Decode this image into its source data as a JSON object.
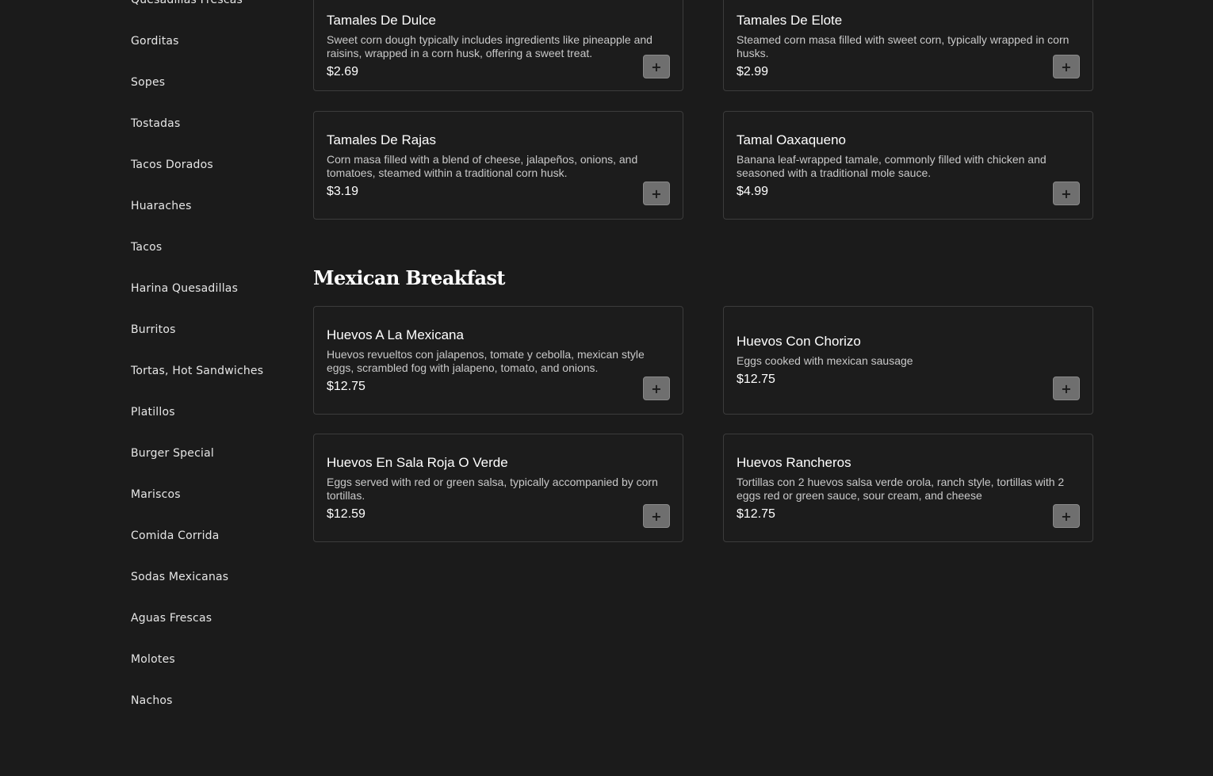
{
  "sidebar": {
    "items": [
      "Quesadillas Frescas",
      "Gorditas",
      "Sopes",
      "Tostadas",
      "Tacos Dorados",
      "Huaraches",
      "Tacos",
      "Harina Quesadillas",
      "Burritos",
      "Tortas, Hot Sandwiches",
      "Platillos",
      "Burger Special",
      "Mariscos",
      "Comida Corrida",
      "Sodas Mexicanas",
      "Aguas Frescas",
      "Molotes",
      "Nachos"
    ]
  },
  "tamales": {
    "items": [
      {
        "name": "Tamales De Dulce",
        "description": "Sweet corn dough typically includes ingredients like pineapple and raisins, wrapped in a corn husk, offering a sweet treat.",
        "price": "$2.69",
        "add_label": "+"
      },
      {
        "name": "Tamales De Elote",
        "description": "Steamed corn masa filled with sweet corn, typically wrapped in corn husks.",
        "price": "$2.99",
        "add_label": "+"
      },
      {
        "name": "Tamales De Rajas",
        "description": "Corn masa filled with a blend of cheese, jalapeños, onions, and tomatoes, steamed within a traditional corn husk.",
        "price": "$3.19",
        "add_label": "+"
      },
      {
        "name": "Tamal Oaxaqueno",
        "description": "Banana leaf-wrapped tamale, commonly filled with chicken and seasoned with a traditional mole sauce.",
        "price": "$4.99",
        "add_label": "+"
      }
    ]
  },
  "breakfast": {
    "title": "Mexican Breakfast",
    "items": [
      {
        "name": "Huevos A La Mexicana",
        "description": "Huevos revueltos con jalapenos, tomate y cebolla, mexican style eggs, scrambled fog with jalapeno, tomato, and onions.",
        "price": "$12.75",
        "add_label": "+"
      },
      {
        "name": "Huevos Con Chorizo",
        "description": "Eggs cooked with mexican sausage",
        "price": "$12.75",
        "add_label": "+"
      },
      {
        "name": "Huevos En Sala Roja O Verde",
        "description": "Eggs served with red or green salsa, typically accompanied by corn tortillas.",
        "price": "$12.59",
        "add_label": "+"
      },
      {
        "name": "Huevos Rancheros",
        "description": "Tortillas con 2 huevos salsa verde orola, ranch style, tortillas with 2 eggs red or green sauce, sour cream, and cheese",
        "price": "$12.75",
        "add_label": "+"
      }
    ]
  }
}
